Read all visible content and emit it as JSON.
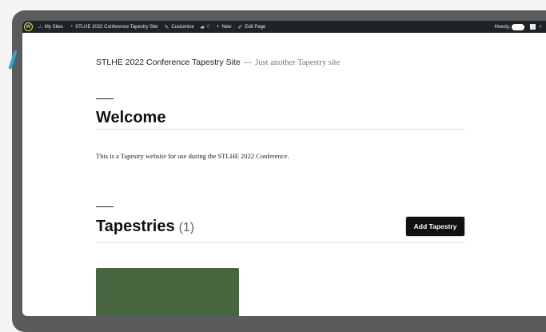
{
  "adminbar": {
    "my_sites": "My Sites",
    "site_name": "STLHE 2022 Conference Tapestry Site",
    "customize": "Customize",
    "comments_count": "0",
    "new": "New",
    "edit_page": "Edit Page",
    "howdy": "Howdy,"
  },
  "site": {
    "title": "STLHE 2022 Conference Tapestry Site",
    "separator": "—",
    "tagline": "Just another Tapestry site"
  },
  "page": {
    "welcome_heading": "Welcome",
    "intro_text": "This is a Tapestry website for use during the STLHE 2022 Conference.",
    "tapestries_heading": "Tapestries",
    "tapestries_count": "(1)",
    "add_button_label": "Add Tapestry"
  },
  "icons": {
    "logo": "wordpress-logo-icon",
    "my_sites": "my-sites-icon",
    "site": "dashboard-icon",
    "customize": "brush-icon",
    "comments": "comment-bubble-icon",
    "new": "plus-icon",
    "edit": "pencil-icon",
    "search": "search-icon"
  },
  "colors": {
    "adminbar_bg": "#1d2327",
    "logo_highlight": "#e3e23a",
    "callout_lines": "#2fa3d6",
    "card_green": "#476640",
    "button_bg": "#111111"
  }
}
